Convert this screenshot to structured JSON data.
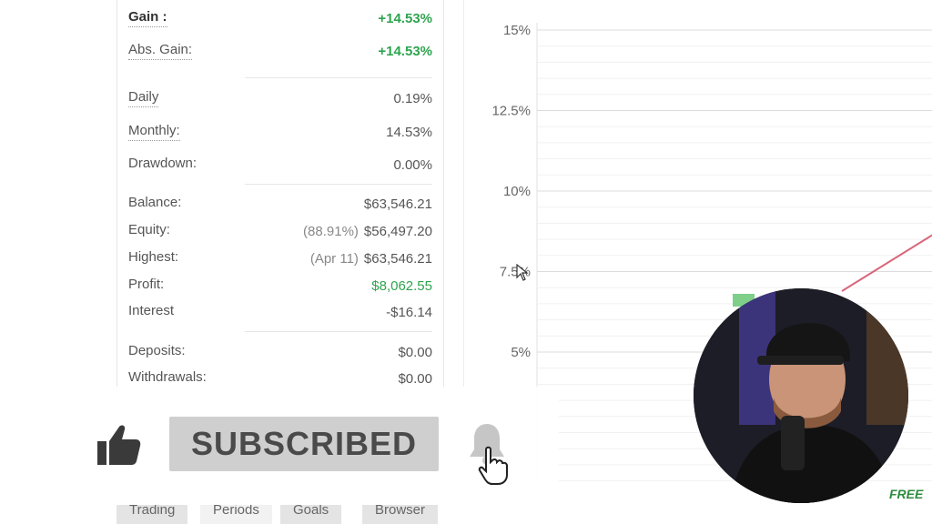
{
  "stats": {
    "gain": {
      "label": "Gain :",
      "value": "+14.53%"
    },
    "abs_gain": {
      "label": "Abs. Gain:",
      "value": "+14.53%"
    },
    "daily": {
      "label": "Daily",
      "value": "0.19%"
    },
    "monthly": {
      "label": "Monthly:",
      "value": "14.53%"
    },
    "drawdown": {
      "label": "Drawdown:",
      "value": "0.00%"
    },
    "balance": {
      "label": "Balance:",
      "value": "$63,546.21"
    },
    "equity": {
      "label": "Equity:",
      "extra": "(88.91%)",
      "value": "$56,497.20"
    },
    "highest": {
      "label": "Highest:",
      "extra": "(Apr 11)",
      "value": "$63,546.21"
    },
    "profit": {
      "label": "Profit:",
      "value": "$8,062.55"
    },
    "interest": {
      "label": "Interest",
      "value": "-$16.14"
    },
    "deposits": {
      "label": "Deposits:",
      "value": "$0.00"
    },
    "withdrawals": {
      "label": "Withdrawals:",
      "value": "$0.00"
    }
  },
  "chart_data": {
    "type": "line",
    "y_ticks": [
      "15%",
      "12.5%",
      "10%",
      "7.5%",
      "5%"
    ],
    "ylim": [
      5,
      15
    ],
    "series_color": "#d9667a",
    "bar_color": "#7fcf8a"
  },
  "tabs": [
    "Trading",
    "Periods",
    "Goals",
    "Browser"
  ],
  "overlay": {
    "subscribed_label": "SUBSCRIBED",
    "watermark": "FREE"
  }
}
